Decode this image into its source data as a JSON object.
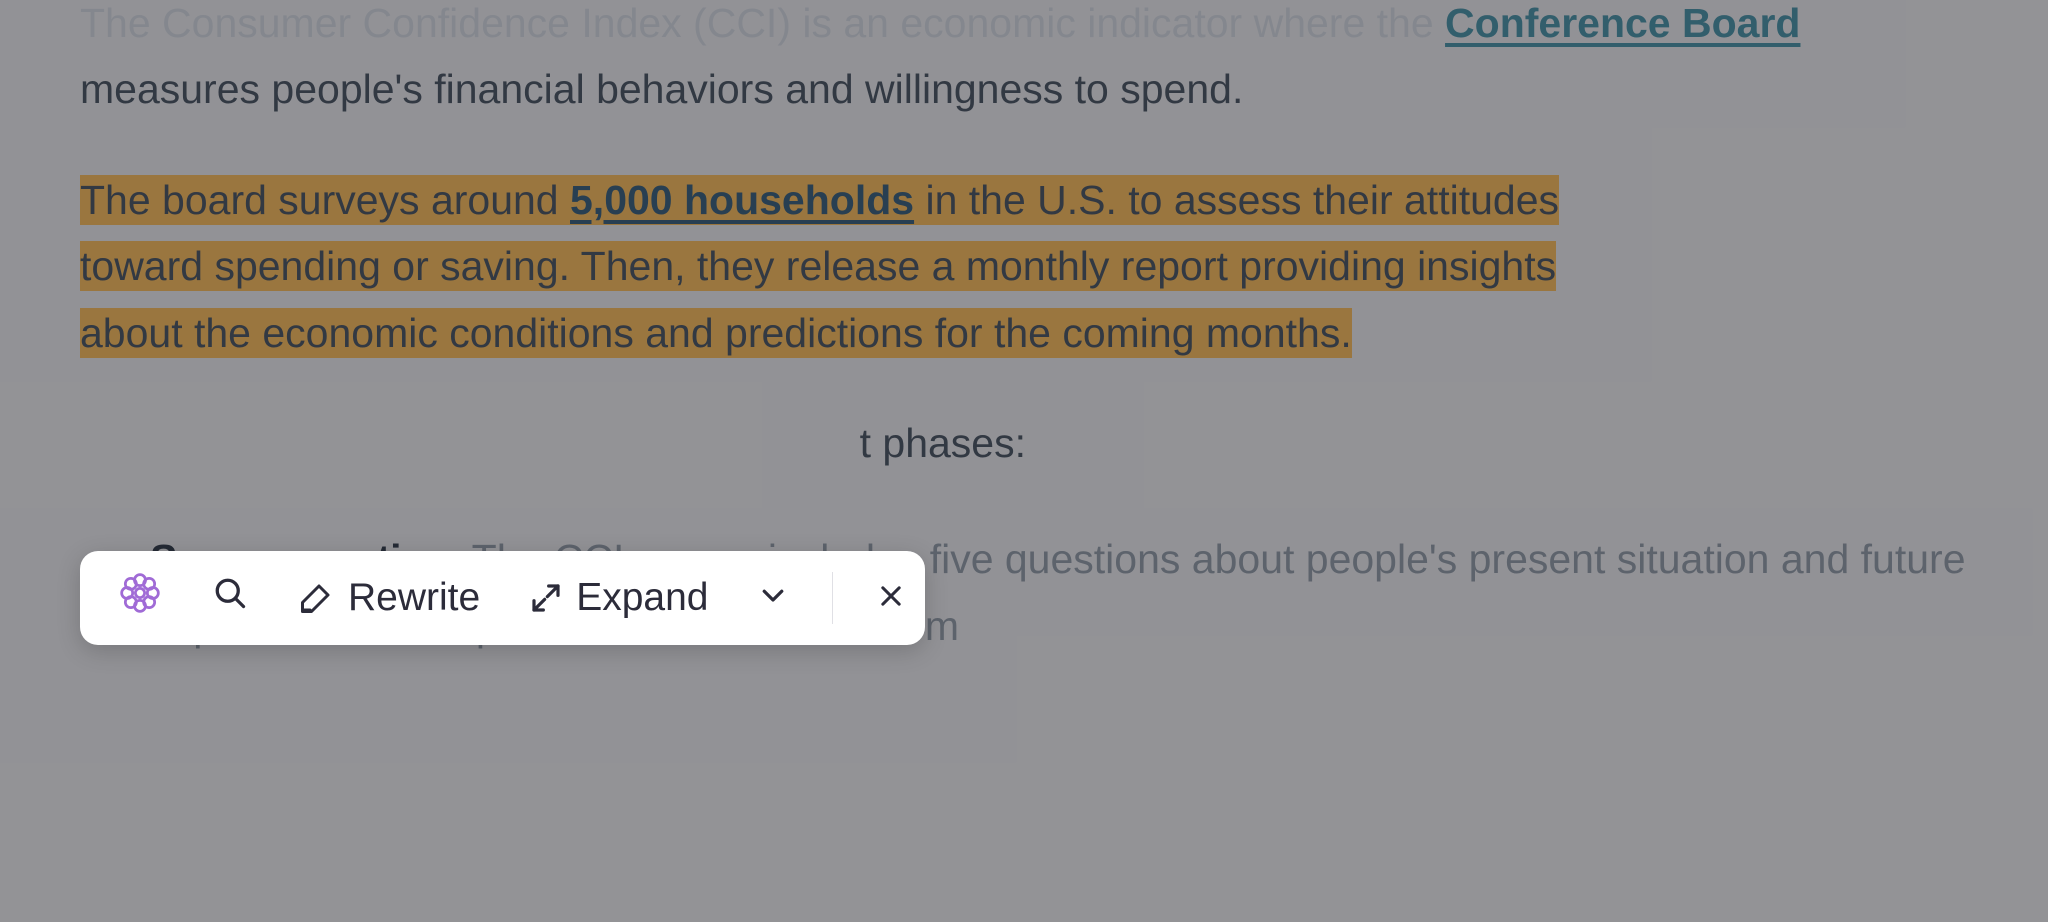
{
  "paragraph1": {
    "leading": "The Consumer Confidence Index (CCI) is an economic indicator where the ",
    "link": "Conference Board",
    "trailing": " measures people's financial behaviors and willingness to spend."
  },
  "highlighted": {
    "pre": "The board surveys around ",
    "link": "5,000 households",
    "post1": " in the U.S. to assess their attitudes ",
    "post2": "toward spending or saving. Then, they release a monthly report providing insights ",
    "post3": "about the economic conditions and predictions for the coming months."
  },
  "phases_tail": "t phases:",
  "bullet": {
    "label": "Survey creation.",
    "text": " The CCI survey includes five questions about people's present situation and future expectations. Respondents can choose from"
  },
  "toolbar": {
    "rewrite": "Rewrite",
    "expand": "Expand"
  }
}
